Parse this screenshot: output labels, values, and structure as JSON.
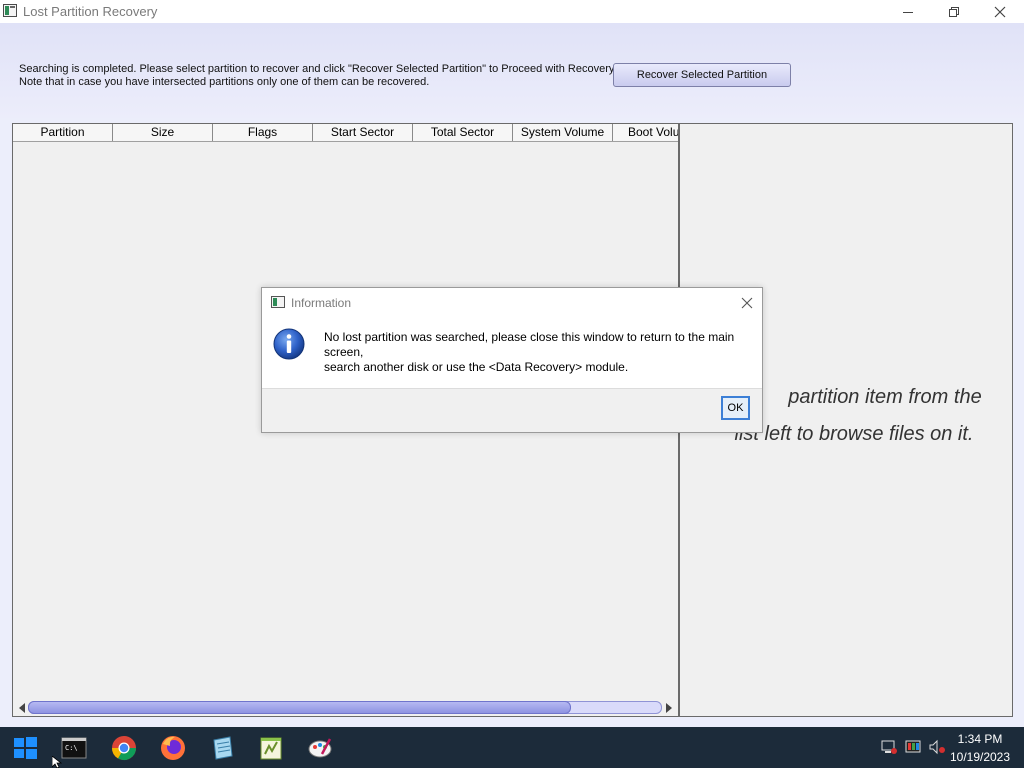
{
  "window": {
    "title": "Lost Partition Recovery",
    "minimize_icon": "minimize-icon",
    "maximize_icon": "restore-icon",
    "close_icon": "close-icon"
  },
  "top_panel": {
    "line1": "Searching is completed. Please select partition to recover and click \"Recover Selected Partition\" to Proceed with Recovery.",
    "line2": "Note that in case you have intersected partitions only one of them can be recovered.",
    "recover_button": "Recover Selected Partition"
  },
  "partition_table": {
    "columns": [
      "Partition",
      "Size",
      "Flags",
      "Start Sector",
      "Total Sector",
      "System Volume",
      "Boot Volu"
    ],
    "rows": []
  },
  "right_pane": {
    "hint_line1": "partition item from the",
    "hint_line2": "list left to browse files on it."
  },
  "dialog": {
    "title": "Information",
    "icon": "info-icon",
    "message_line1": "No lost partition was searched, please close this window to return to the main screen,",
    "message_line2": "search another disk or use the <Data Recovery> module.",
    "ok_button": "OK"
  },
  "taskbar": {
    "apps": [
      "windows-start",
      "command-prompt",
      "chrome",
      "firefox",
      "notepad",
      "notepad-plus",
      "paint"
    ],
    "time": "1:34 PM",
    "date": "10/19/2023",
    "colors": {
      "background": "#1c2b3a"
    }
  },
  "colors": {
    "accent": "#8e93e2",
    "panel_bg": "#e6e8fa"
  }
}
